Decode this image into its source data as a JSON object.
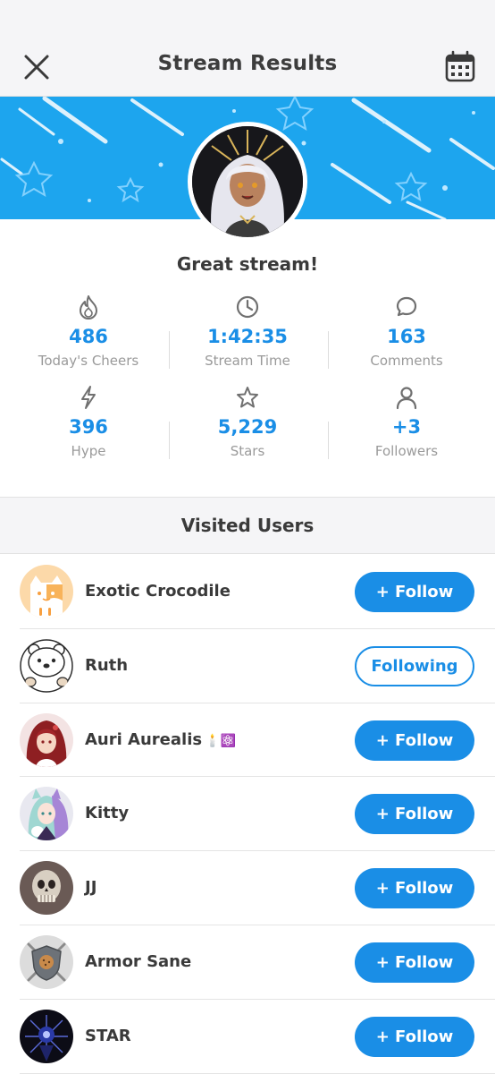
{
  "header": {
    "title": "Stream Results",
    "close_icon": "close-icon",
    "calendar_icon": "calendar-icon"
  },
  "colors": {
    "accent": "#1a8ee6",
    "banner": "#1da5ee",
    "label_gray": "#9a9a9a",
    "header_bg": "#f5f5f7"
  },
  "summary": {
    "message": "Great stream!"
  },
  "stats": [
    {
      "icon": "flame-icon",
      "value": "486",
      "label": "Today's Cheers"
    },
    {
      "icon": "clock-icon",
      "value": "1:42:35",
      "label": "Stream Time"
    },
    {
      "icon": "chat-bubble-icon",
      "value": "163",
      "label": "Comments"
    },
    {
      "icon": "lightning-icon",
      "value": "396",
      "label": "Hype"
    },
    {
      "icon": "star-icon",
      "value": "5,229",
      "label": "Stars"
    },
    {
      "icon": "person-icon",
      "value": "+3",
      "label": "Followers"
    }
  ],
  "visited": {
    "title": "Visited Users",
    "users": [
      {
        "name": "Exotic Crocodile",
        "button": "+ Follow",
        "state": "follow"
      },
      {
        "name": "Ruth",
        "button": "Following",
        "state": "following"
      },
      {
        "name": "Auri Aurealis",
        "badges": "🕯️⚛️",
        "button": "+ Follow",
        "state": "follow"
      },
      {
        "name": "Kitty",
        "button": "+ Follow",
        "state": "follow"
      },
      {
        "name": "JJ",
        "button": "+ Follow",
        "state": "follow"
      },
      {
        "name": "Armor Sane",
        "button": "+ Follow",
        "state": "follow"
      },
      {
        "name": "STAR",
        "button": "+ Follow",
        "state": "follow"
      }
    ]
  }
}
